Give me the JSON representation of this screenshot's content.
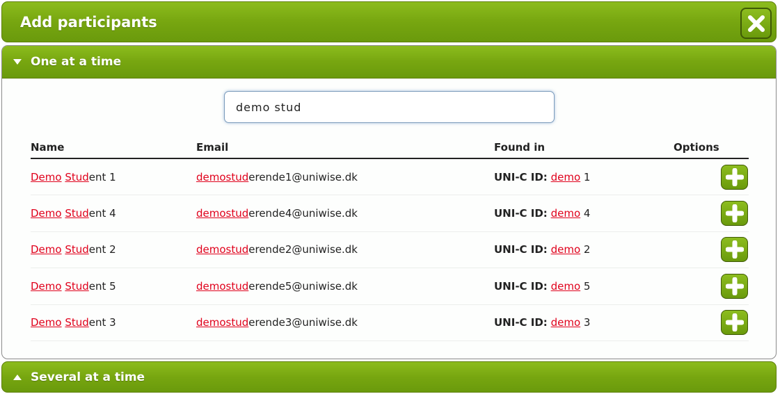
{
  "dialog": {
    "title": "Add participants",
    "close_icon": "close-icon"
  },
  "one_at_a_time": {
    "label": "One at a time",
    "expanded": true,
    "search": {
      "value": "demo stud"
    },
    "table": {
      "headers": {
        "name": "Name",
        "email": "Email",
        "found_in": "Found in",
        "options": "Options"
      },
      "rows": [
        {
          "name_hl1": "Demo",
          "name_hl2": "Stud",
          "name_rest": "ent 1",
          "email_hl": "demostud",
          "email_rest": "erende1@uniwise.dk",
          "found_label": "UNI-C ID:",
          "found_hl": "demo",
          "found_rest": "1"
        },
        {
          "name_hl1": "Demo",
          "name_hl2": "Stud",
          "name_rest": "ent 4",
          "email_hl": "demostud",
          "email_rest": "erende4@uniwise.dk",
          "found_label": "UNI-C ID:",
          "found_hl": "demo",
          "found_rest": "4"
        },
        {
          "name_hl1": "Demo",
          "name_hl2": "Stud",
          "name_rest": "ent 2",
          "email_hl": "demostud",
          "email_rest": "erende2@uniwise.dk",
          "found_label": "UNI-C ID:",
          "found_hl": "demo",
          "found_rest": "2"
        },
        {
          "name_hl1": "Demo",
          "name_hl2": "Stud",
          "name_rest": "ent 5",
          "email_hl": "demostud",
          "email_rest": "erende5@uniwise.dk",
          "found_label": "UNI-C ID:",
          "found_hl": "demo",
          "found_rest": "5"
        },
        {
          "name_hl1": "Demo",
          "name_hl2": "Stud",
          "name_rest": "ent 3",
          "email_hl": "demostud",
          "email_rest": "erende3@uniwise.dk",
          "found_label": "UNI-C ID:",
          "found_hl": "demo",
          "found_rest": "3"
        }
      ]
    }
  },
  "several_at_a_time": {
    "label": "Several at a time",
    "expanded": false
  },
  "colors": {
    "accent_green": "#77a610",
    "highlight_red": "#e0001b"
  }
}
